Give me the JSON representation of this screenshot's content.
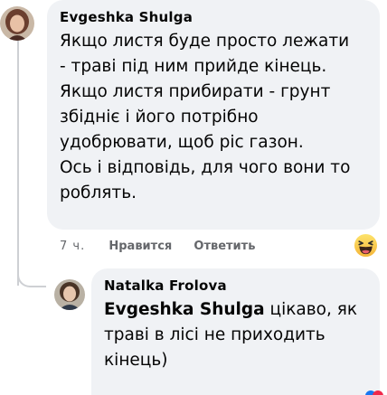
{
  "comment": {
    "author": "Evgeshka Shulga",
    "lines": [
      "Якщо листя буде просто лежати",
      "- траві під ним прийде кінець.",
      "Якщо листя прибирати - грунт",
      "збідніє і його потрібно",
      "удобрювати, щоб ріс газон.",
      "Ось і відповідь, для чого вони то",
      "роблять."
    ],
    "actions": {
      "time": "7 ч.",
      "like": "Нравится",
      "reply": "Ответить"
    },
    "reaction": "laughing-emoji"
  },
  "reply": {
    "author": "Natalka Frolova",
    "mention": "Evgeshka Shulga",
    "line1_rest": " цікаво, як",
    "line2": "траві в лісі не приходить",
    "line3": "кінець)"
  },
  "colors": {
    "bubble": "#f0f2f5",
    "meta": "#65676b",
    "thread": "#ced0d4"
  }
}
